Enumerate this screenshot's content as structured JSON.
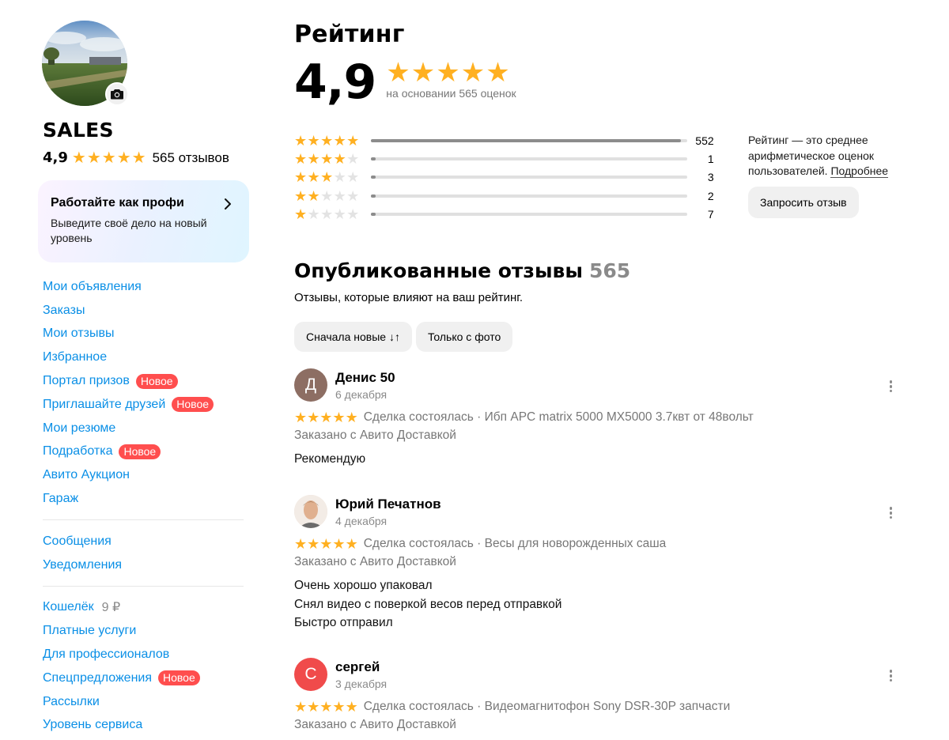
{
  "profile": {
    "name": "SALES",
    "rating": "4,9",
    "stars": 5,
    "reviews_count": "565 отзывов",
    "camera_icon": "camera-icon"
  },
  "promo": {
    "title": "Работайте как профи",
    "subtitle": "Выведите своё дело на новый уровень"
  },
  "nav": {
    "group1": [
      {
        "label": "Мои объявления"
      },
      {
        "label": "Заказы"
      },
      {
        "label": "Мои отзывы"
      },
      {
        "label": "Избранное"
      },
      {
        "label": "Портал призов",
        "badge": "Новое"
      },
      {
        "label": "Приглашайте друзей",
        "badge": "Новое"
      },
      {
        "label": "Мои резюме"
      },
      {
        "label": "Подработка",
        "badge": "Новое"
      },
      {
        "label": "Авито Аукцион"
      },
      {
        "label": "Гараж"
      }
    ],
    "group2": [
      {
        "label": "Сообщения"
      },
      {
        "label": "Уведомления"
      }
    ],
    "group3": [
      {
        "label": "Кошелёк",
        "amount": "9 ₽"
      },
      {
        "label": "Платные услуги"
      },
      {
        "label": "Для профессионалов"
      },
      {
        "label": "Спецпредложения",
        "badge": "Новое"
      },
      {
        "label": "Рассылки"
      },
      {
        "label": "Уровень сервиса"
      }
    ]
  },
  "rating": {
    "title": "Рейтинг",
    "value": "4,9",
    "based_on": "на основании 565 оценок",
    "distribution": [
      {
        "stars": 5,
        "count": "552",
        "fraction": 0.98
      },
      {
        "stars": 4,
        "count": "1",
        "fraction": 0.01
      },
      {
        "stars": 3,
        "count": "3",
        "fraction": 0.01
      },
      {
        "stars": 2,
        "count": "2",
        "fraction": 0.01
      },
      {
        "stars": 1,
        "count": "7",
        "fraction": 0.01
      }
    ],
    "note": "Рейтинг — это среднее арифметическое оценок пользователей.",
    "note_link": "Подробнее",
    "request_button": "Запросить отзыв"
  },
  "reviews": {
    "title": "Опубликованные отзывы",
    "count": "565",
    "subtitle": "Отзывы, которые влияют на ваш рейтинг.",
    "sort_label": "Сначала новые ↓↑",
    "photo_filter": "Только с фото",
    "items": [
      {
        "initial": "Д",
        "avatar_color": "#8d6e63",
        "name": "Денис 50",
        "date": "6 декабря",
        "stars": 5,
        "deal": "Сделка состоялась · Ибп APC matrix 5000 MX5000 3.7квт от 48вольт",
        "delivery": "Заказано с Авито Доставкой",
        "text": [
          "Рекомендую"
        ]
      },
      {
        "initial": "",
        "avatar_color": "#e9d7c6",
        "name": "Юрий Печатнов",
        "date": "4 декабря",
        "stars": 5,
        "deal": "Сделка состоялась · Весы для новорожденных саша",
        "delivery": "Заказано с Авито Доставкой",
        "text": [
          "Очень хорошо упаковал",
          "Снял видео с поверкой весов перед отправкой",
          "Быстро отправил"
        ]
      },
      {
        "initial": "С",
        "avatar_color": "#f04b4b",
        "name": "сергей",
        "date": "3 декабря",
        "stars": 5,
        "deal": "Сделка состоялась · Видеомагнитофон Sony DSR-30P запчасти",
        "delivery": "Заказано с Авито Доставкой",
        "text": []
      }
    ]
  },
  "colors": {
    "star": "#ffb021",
    "link": "#0a8fe6",
    "badge": "#ff4e4e"
  }
}
